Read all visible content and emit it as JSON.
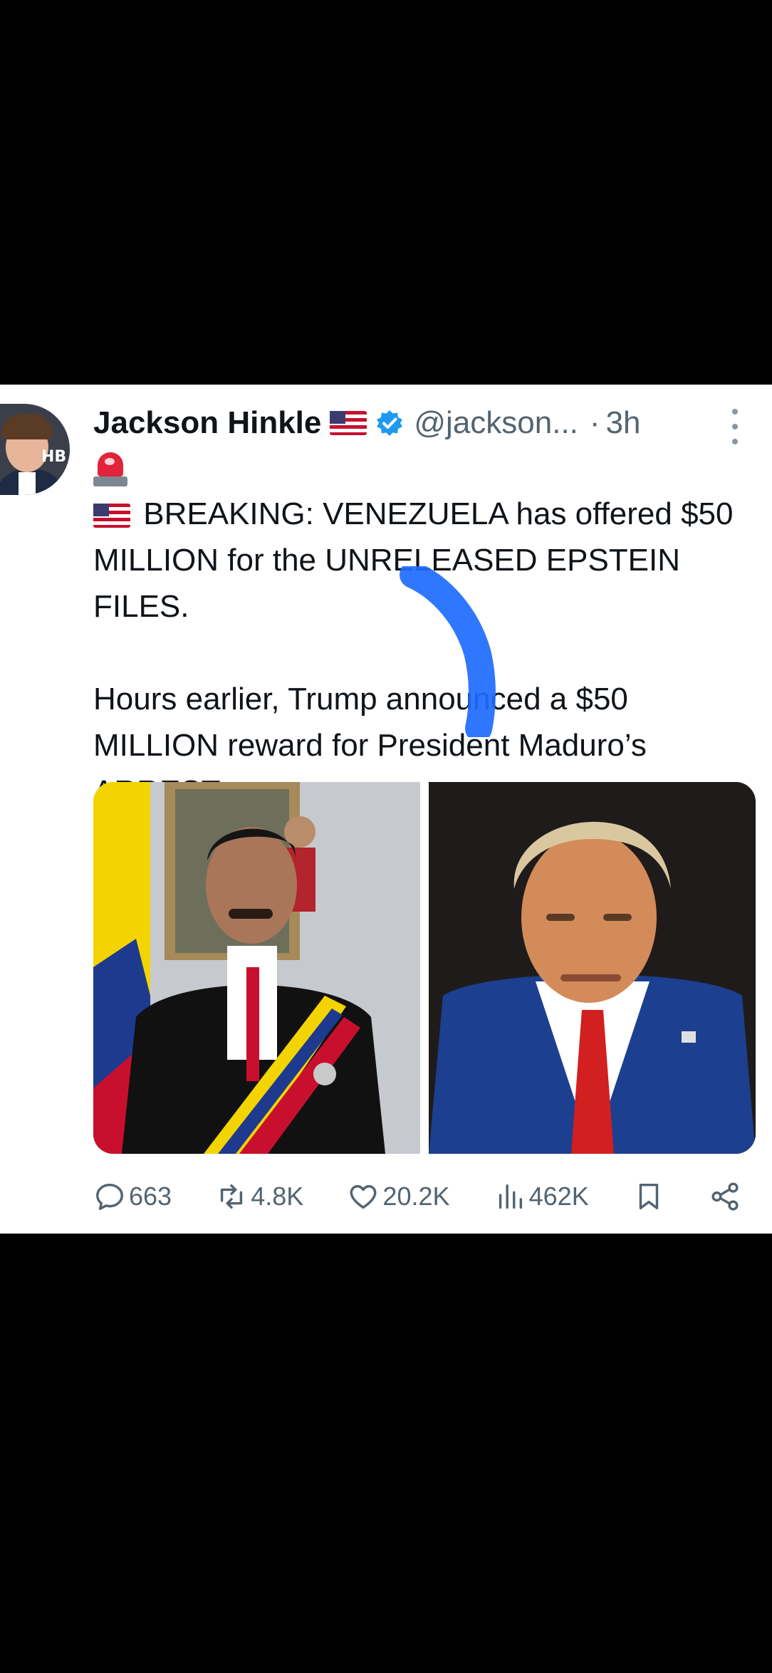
{
  "tweet": {
    "author_name": "Jackson Hinkle",
    "avatar_tag": "HB",
    "handle": "@jackson...",
    "separator": "·",
    "time": "3h",
    "text_line1": "BREAKING: VENEZUELA has offered $50 MILLION for the UNRELEASED EPSTEIN FILES.",
    "text_para2": "Hours earlier, Trump announced a $50 MILLION reward for President Maduro’s ARREST."
  },
  "actions": {
    "replies": "663",
    "reposts": "4.8K",
    "likes": "20.2K",
    "views": "462K"
  },
  "icons": {
    "verified": "verified-badge-icon",
    "more": "more-vertical-icon",
    "reply": "reply-icon",
    "repost": "repost-icon",
    "like": "heart-icon",
    "views": "views-bar-chart-icon",
    "bookmark": "bookmark-icon",
    "share": "share-icon"
  },
  "colors": {
    "verified_blue": "#1d9bf0",
    "text": "#0f1419",
    "secondary": "#536471",
    "highlight_mark": "#1e6bff"
  }
}
